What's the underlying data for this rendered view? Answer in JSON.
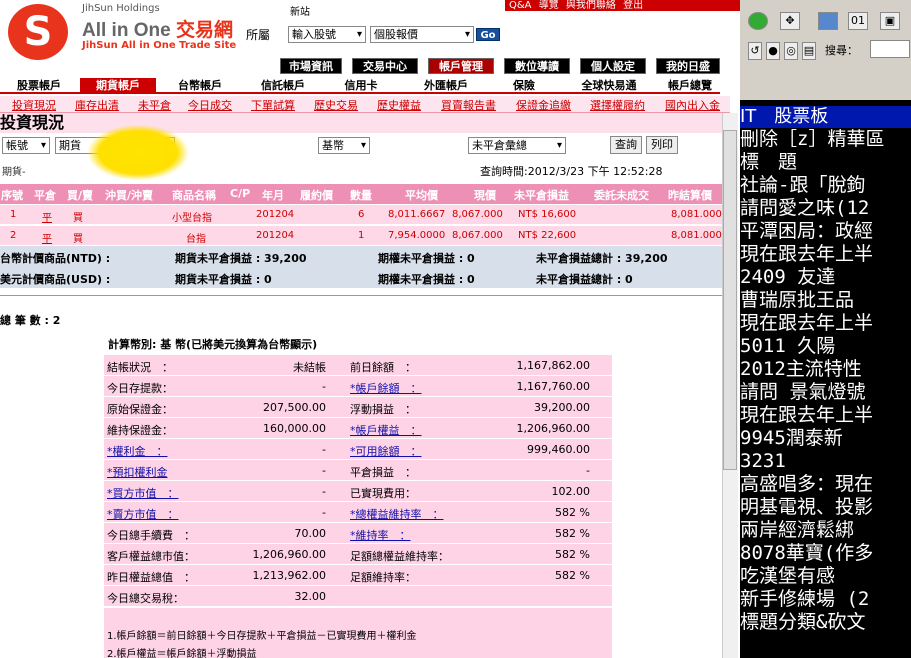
{
  "brand": {
    "holding": "JihSun Holdings",
    "name_en": "All in One",
    "name_zh": "交易網",
    "sub": "JihSun All in One Trade Site"
  },
  "topbar": [
    "Q&A",
    "導覽",
    "與我們聯絡",
    "登出"
  ],
  "newsite": "新站",
  "location_label": "所屬",
  "search": {
    "input_value": "輸入股號",
    "select_value": "個股報價",
    "go": "Go"
  },
  "nav2": [
    "市場資訊",
    "交易中心",
    "帳戶管理",
    "數位導讀",
    "個人設定",
    "我的日盛"
  ],
  "tabs": [
    "股票帳戶",
    "期貨帳戶",
    "台幣帳戶",
    "信託帳戶",
    "信用卡",
    "外匯帳戶",
    "保險",
    "全球快易通",
    "帳戶總覽"
  ],
  "subnav": [
    "投資現況",
    "庫存出清",
    "未平倉",
    "今日成交",
    "下單試算",
    "歷史交易",
    "歷史權益",
    "買賣報告書",
    "保證金追繳",
    "選擇權履約",
    "國內出入金"
  ],
  "page_title": "投資現況",
  "controls": {
    "account_select": "帳號",
    "futures_select": "期貨",
    "currency_select": "基幣",
    "type_select": "未平倉彙總",
    "query_btn": "查詢",
    "print_btn": "列印",
    "futures_label": "期貨-"
  },
  "query_time": "查詢時間:2012/3/23 下午 12:52:28",
  "grid": {
    "headers": [
      "序號",
      "平倉",
      "買/賣",
      "沖買/沖賣",
      "商品名稱",
      "C/P",
      "年月",
      "履約價",
      "數量",
      "平均價",
      "現價",
      "未平倉損益",
      "委託未成交",
      "昨結算價"
    ],
    "rows": [
      {
        "no": "1",
        "close": "平",
        "side": "買",
        "name": "小型台指",
        "ym": "201204",
        "qty": "6",
        "avg": "8,011.6667",
        "price": "8,067.000",
        "pnl": "NT$ 16,600",
        "settle": "8,081.000"
      },
      {
        "no": "2",
        "close": "平",
        "side": "買",
        "name": "台指",
        "ym": "201204",
        "qty": "1",
        "avg": "7,954.0000",
        "price": "8,067.000",
        "pnl": "NT$ 22,600",
        "settle": "8,081.000"
      }
    ]
  },
  "summary": [
    {
      "label": "台幣計價商品(NTD) :",
      "fut": "期貨未平倉損益 : 39,200",
      "opt": "期權未平倉損益 : 0",
      "total": "未平倉損益總計 : 39,200"
    },
    {
      "label": "美元計價商品(USD) :",
      "fut": "期貨未平倉損益 : 0",
      "opt": "期權未平倉損益 : 0",
      "total": "未平倉損益總計 : 0"
    }
  ],
  "count": "總 筆 數 : 2",
  "calc_title": "計算幣別: 基 幣(已將美元換算為台幣顯示)",
  "table": [
    [
      "結帳狀況　：",
      "未結帳",
      "前日餘額　：",
      "1,167,862.00"
    ],
    [
      "今日存提款：",
      "-",
      "*帳戶餘額　：",
      "1,167,760.00"
    ],
    [
      "原始保證金：",
      "207,500.00",
      "浮動損益　：",
      "39,200.00"
    ],
    [
      "維持保證金：",
      "160,000.00",
      "*帳戶權益　：",
      "1,206,960.00"
    ],
    [
      "*權利金　：",
      "-",
      "*可用餘額　：",
      "999,460.00"
    ],
    [
      "*預扣權利金",
      "-",
      "平倉損益　：",
      "-"
    ],
    [
      "*買方市值　：",
      "-",
      "已實現費用：",
      "102.00"
    ],
    [
      "*賣方市值　：",
      "-",
      "*總權益維持率　：",
      "582 %"
    ],
    [
      "今日總手續費　：",
      "70.00",
      "*維持率　：",
      "582 %"
    ],
    [
      "客戶權益總市值：",
      "1,206,960.00",
      "足額總權益維持率：",
      "582 %"
    ],
    [
      "昨日權益總值　：",
      "1,213,962.00",
      "足額維持率：",
      "582 %"
    ],
    [
      "今日總交易稅：",
      "32.00",
      "",
      ""
    ]
  ],
  "notes": [
    "1.帳戶餘額＝前日餘額＋今日存提款＋平倉損益－已實現費用＋權利金",
    "2.帳戶權益＝帳戶餘額＋浮動損益"
  ],
  "right": {
    "search_label": "搜尋：",
    "board_title": "IT　股票板",
    "lines": [
      "刪除［z］精華區",
      "標　題",
      "社論-跟「脫鉤",
      "請問愛之味(12",
      "平潭困局：政經",
      "現在跟去年上半",
      "2409 友達",
      "曹瑞原批王品",
      "現在跟去年上半",
      "5011 久陽",
      "2012主流特性",
      "請問 景氣燈號",
      "現在跟去年上半",
      "9945潤泰新",
      "3231",
      "高盛唱多：現在",
      "明基電視、投影",
      "兩岸經濟鬆綁",
      "8078華寶(作多",
      "吃漢堡有感",
      "新手修練場 (2",
      "標題分類&砍文"
    ]
  }
}
